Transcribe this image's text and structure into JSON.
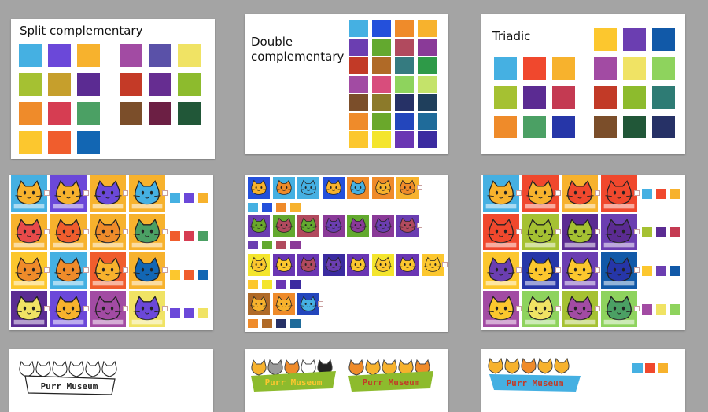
{
  "boards": {
    "split_title": "Split complementary",
    "double_title": "Double complementary",
    "triadic_title": "Triadic",
    "logo_text": "Purr Museum"
  },
  "palettes": {
    "split": [
      [
        "#45b0e2",
        "#6b48d9",
        "#f7b22d",
        "#a24ba3",
        "#5a51a8",
        "#f0e364"
      ],
      [
        "#a5c132",
        "#c69f2c",
        "#5b2b92",
        "#c43a27",
        "#662d91",
        "#8dbb2d"
      ],
      [
        "#ef8b2a",
        "#d63d52",
        "#4ba064",
        "#7b4e2a",
        "#6c1f44",
        "#215738"
      ],
      [
        "#fcc72e",
        "#f05d2d",
        "#1266b3"
      ]
    ],
    "double": [
      [
        "#45b0e2",
        "#2450db",
        "#ef8b2a",
        "#f7b22d"
      ],
      [
        "#6b3eb1",
        "#63a92f",
        "#b14a5e",
        "#8a3a98"
      ],
      [
        "#c23a27",
        "#b06a27",
        "#357b80",
        "#2e9a48"
      ],
      [
        "#a24ba3",
        "#d84d7c",
        "#8ed35d",
        "#c4e36a"
      ],
      [
        "#7b4e2a",
        "#8c7a2a",
        "#263166",
        "#1f3f5c"
      ],
      [
        "#ef8b2a",
        "#6aa82b",
        "#2346bc",
        "#1f6b9a"
      ],
      [
        "#fcc72e",
        "#f4e52d",
        "#6a36b3",
        "#3b2ba0"
      ]
    ],
    "triadic_left": [
      [
        "#45b0e2",
        "#f0482d",
        "#f7b22d"
      ],
      [
        "#a5c132",
        "#5b2b92",
        "#c43a52"
      ],
      [
        "#ef8b2a",
        "#4ba064",
        "#2636a8"
      ]
    ],
    "triadic_right": [
      [
        "#fcc72e",
        "#6b3eb1",
        "#1159a8"
      ],
      [
        "#a24ba3",
        "#f0e364",
        "#8ed35d"
      ],
      [
        "#c23a27",
        "#8dbb2d",
        "#2e7b74"
      ],
      [
        "#7b4e2a",
        "#215738",
        "#263166"
      ]
    ]
  },
  "tiles": {
    "left": [
      [
        "#45b0e2",
        "#6b48d9",
        "#f7b22d",
        "#f7b22d"
      ],
      [
        "#f7b22d",
        "#f7b22d",
        "#f7b22d",
        "#f7b22d"
      ],
      [
        "#fcc72e",
        "#45b0e2",
        "#f05d2d",
        "#f7b22d"
      ],
      [
        "#5b2b92",
        "#6b48d9",
        "#a24ba3",
        "#f0e364"
      ]
    ],
    "left_cats": [
      [
        "#f7b22d",
        "#f7b22d",
        "#6b48d9",
        "#45b0e2"
      ],
      [
        "#e84a4a",
        "#f05d2d",
        "#ef8b2a",
        "#4ba064"
      ],
      [
        "#ef8b2a",
        "#ef8b2a",
        "#f7b22d",
        "#1266b3"
      ],
      [
        "#f0e364",
        "#f7b22d",
        "#a24ba3",
        "#6b48d9"
      ]
    ],
    "left_swatches": [
      [
        "#45b0e2",
        "#6b48d9",
        "#f7b22d"
      ],
      [
        "#f05d2d",
        "#d63d52",
        "#4ba064"
      ],
      [
        "#fcc72e",
        "#f05d2d",
        "#1266b3"
      ],
      [
        "#6b48d9",
        "#6b48d9",
        "#f0e364"
      ]
    ],
    "right": [
      [
        "#45b0e2",
        "#f0482d",
        "#f7b22d",
        "#f0482d"
      ],
      [
        "#f0482d",
        "#a5c132",
        "#5b2b92",
        "#6b3eb1"
      ],
      [
        "#fcc72e",
        "#2636a8",
        "#6b3eb1",
        "#1159a8"
      ],
      [
        "#a24ba3",
        "#8ed35d",
        "#a5c132",
        "#8ed35d"
      ]
    ],
    "right_cats": [
      [
        "#f7b22d",
        "#f7b22d",
        "#f0482d",
        "#f0482d"
      ],
      [
        "#f0482d",
        "#a5c132",
        "#a5c132",
        "#5b2b92"
      ],
      [
        "#6b3eb1",
        "#fcc72e",
        "#fcc72e",
        "#2636a8"
      ],
      [
        "#fcc72e",
        "#f0e364",
        "#a24ba3",
        "#4ba064"
      ]
    ],
    "right_swatches": [
      [
        "#45b0e2",
        "#f0482d",
        "#f7b22d"
      ],
      [
        "#a5c132",
        "#5b2b92",
        "#c43a52"
      ],
      [
        "#fcc72e",
        "#6b3eb1",
        "#1159a8"
      ],
      [
        "#a24ba3",
        "#f0e364",
        "#8ed35d"
      ]
    ],
    "middle_rows": [
      [
        "#2450db",
        "#45b0e2",
        "#45b0e2",
        "#2450db",
        "#ef8b2a",
        "#ef8b2a",
        "#f7b22d"
      ],
      [
        "#6b3eb1",
        "#63a92f",
        "#b14a5e",
        "#8a3a98",
        "#63a92f",
        "#8a3a98",
        "#6b3eb1"
      ],
      [
        "#f4e52d",
        "#6a36b3",
        "#6a36b3",
        "#3b2ba0",
        "#6a36b3",
        "#f4e52d",
        "#6a36b3",
        "#fcc72e"
      ],
      [
        "#b06a27",
        "#ef8b2a",
        "#2346bc"
      ]
    ],
    "middle_cats": [
      [
        "#f7b22d",
        "#ef8b2a",
        "#45b0e2",
        "#f7b22d",
        "#45b0e2",
        "#f7b22d",
        "#ef8b2a"
      ],
      [
        "#6aa82b",
        "#b14a5e",
        "#63a92f",
        "#6b3eb1",
        "#8a3a98",
        "#6b3eb1",
        "#b14a5e"
      ],
      [
        "#fcc72e",
        "#fcc72e",
        "#b14a5e",
        "#6b3eb1",
        "#fcc72e",
        "#fcc72e",
        "#fcc72e",
        "#fcc72e"
      ],
      [
        "#f7b22d",
        "#f7b22d",
        "#45b0e2"
      ]
    ],
    "middle_swatches": [
      [
        "#45b0e2",
        "#2450db",
        "#ef8b2a",
        "#f7b22d"
      ],
      [
        "#6b3eb1",
        "#63a92f",
        "#b14a5e",
        "#8a3a98"
      ],
      [
        "#fcc72e",
        "#f4e52d",
        "#6a36b3",
        "#3b2ba0"
      ],
      [
        "#ef8b2a",
        "#b06a27",
        "#263166",
        "#1f6b9a"
      ]
    ]
  },
  "bottom_swatches": [
    "#45b0e2",
    "#f0482d",
    "#f7b22d"
  ],
  "colors": {
    "background": "#a4a4a4",
    "card": "#ffffff"
  }
}
